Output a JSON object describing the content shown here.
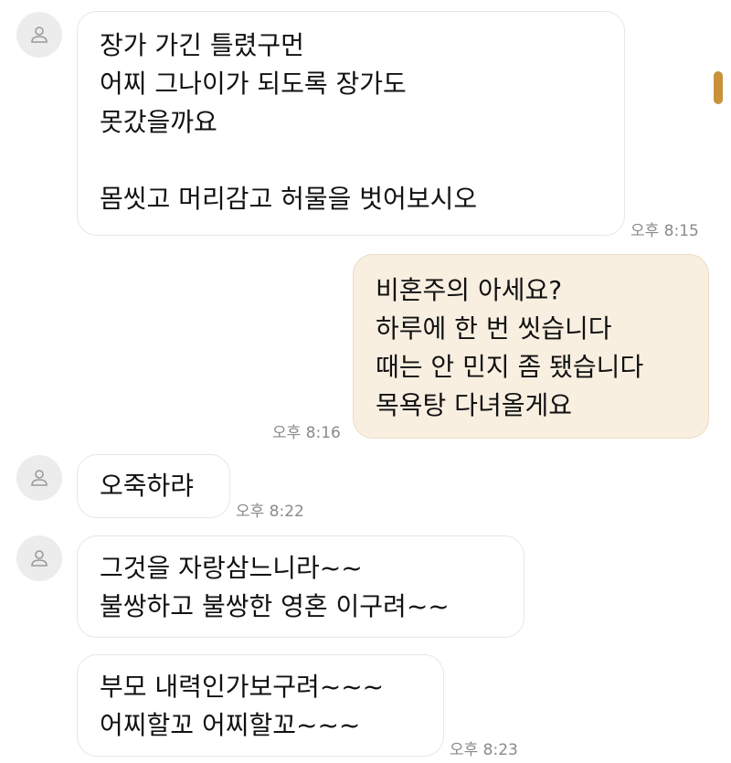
{
  "conversation": {
    "messages": [
      {
        "sender": "other",
        "lines": [
          "장가 가긴 틀렸구먼",
          "어찌 그나이가 되도록 장가도",
          "못갔을까요",
          "",
          "몸씻고 머리감고 허물을 벗어보시오"
        ],
        "time": "오후 8:15"
      },
      {
        "sender": "me",
        "lines": [
          "비혼주의 아세요?",
          "하루에 한 번 씻습니다",
          "때는 안 민지 좀 됐습니다",
          "목욕탕 다녀올게요"
        ],
        "time": "오후 8:16"
      },
      {
        "sender": "other",
        "lines": [
          "오죽하랴"
        ],
        "time": "오후 8:22"
      },
      {
        "sender": "other",
        "lines": [
          "그것을 자랑삼느니라~~",
          "불쌍하고 불쌍한 영혼 이구려~~"
        ]
      },
      {
        "sender": "other",
        "lines": [
          "부모 내력인가보구려~~~",
          "어찌할꼬 어찌할꼬~~~"
        ],
        "time": "오후 8:23"
      }
    ]
  },
  "colors": {
    "sent_bubble": "#f8efe1",
    "received_bubble": "#ffffff",
    "scroll_thumb": "#c8913a",
    "time_text": "#8a8a8a"
  },
  "icons": {
    "avatar": "person-icon"
  }
}
